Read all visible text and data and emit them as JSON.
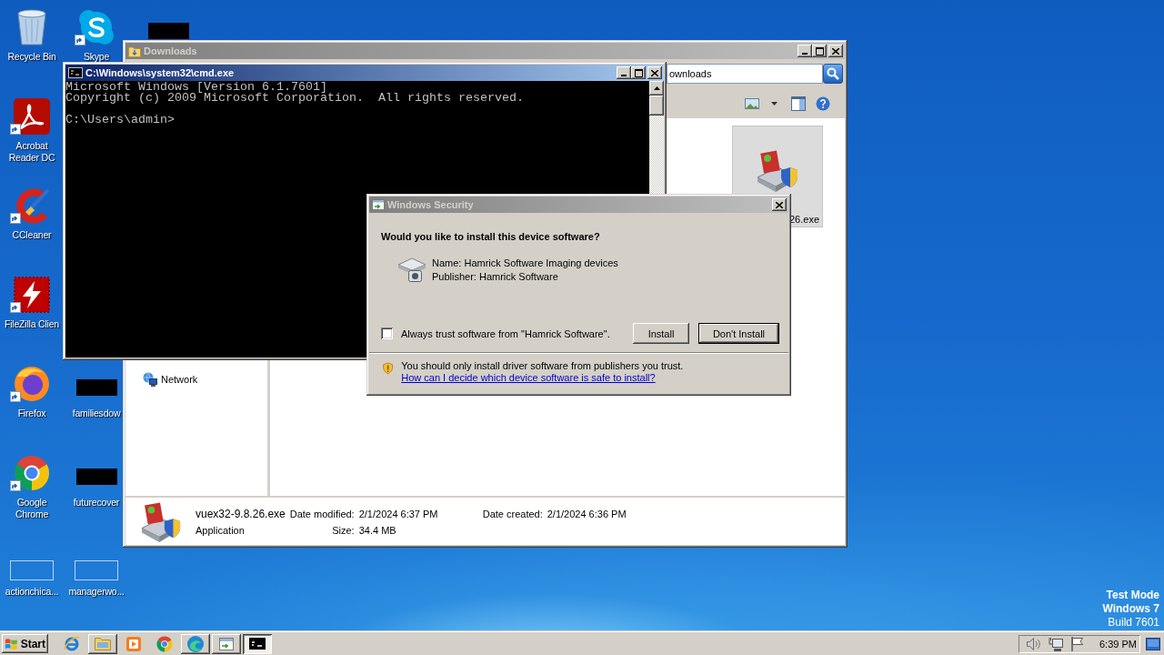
{
  "desktop": {
    "icon_columns": [
      {
        "top": [
          {
            "kind": "recycle-bin",
            "label": "Recycle Bin",
            "shortcut": false
          },
          {
            "kind": "pdf-reader",
            "label": "Acrobat Reader DC",
            "shortcut": true
          },
          {
            "kind": "cleaner",
            "label": "CCleaner",
            "shortcut": true
          },
          {
            "kind": "ftp-client",
            "label": "FileZilla Clien",
            "shortcut": true
          },
          {
            "kind": "fox-browser",
            "label": "Firefox",
            "shortcut": true
          },
          {
            "kind": "wheel-browser",
            "label": "Google Chrome",
            "shortcut": true
          },
          {
            "kind": "blank-file",
            "label": "actionchica...",
            "shortcut": false
          }
        ]
      },
      {
        "top": [
          {
            "kind": "messenger",
            "label": "Skype",
            "shortcut": true
          }
        ],
        "bottom": [
          {
            "kind": "redacted",
            "label": "familiesdow",
            "shortcut": false
          },
          {
            "kind": "redacted",
            "label": "futurecover",
            "shortcut": false
          },
          {
            "kind": "blank-file",
            "label": "managerwo...",
            "shortcut": false
          }
        ]
      },
      {
        "top": [
          {
            "kind": "redacted",
            "shortcut": false
          }
        ]
      }
    ],
    "system_notice": {
      "mode": "Test Mode",
      "os": "Windows 7",
      "build": "Build 7601"
    }
  },
  "explorer_window": {
    "title": "Downloads",
    "active": false,
    "search": {
      "value": "ownloads"
    },
    "nav_items": [
      {
        "label": "Network",
        "selected": false
      }
    ],
    "files": [
      {
        "label": "26.exe",
        "selected": true
      }
    ],
    "details": {
      "name": "vuex32-9.8.26.exe",
      "type": "Application",
      "date_modified": {
        "label": "Date modified:",
        "value": "2/1/2024 6:37 PM"
      },
      "date_created": {
        "label": "Date created:",
        "value": "2/1/2024 6:36 PM"
      },
      "size": {
        "label": "Size:",
        "value": "34.4 MB"
      }
    }
  },
  "cmd_window": {
    "title": "C:\\Windows\\system32\\cmd.exe",
    "active": true,
    "output": [
      "Microsoft Windows [Version 6.1.7601]",
      "Copyright (c) 2009 Microsoft Corporation.  All rights reserved."
    ],
    "prompt": "C:\\Users\\admin>"
  },
  "security_dialog": {
    "title": "Windows Security",
    "active": false,
    "question": "Would you like to install this device software?",
    "device": {
      "name": "Name: Hamrick Software Imaging devices",
      "publisher": "Publisher: Hamrick Software"
    },
    "trust_checkbox": {
      "label": "Always trust software from \"Hamrick Software\".",
      "checked": false
    },
    "buttons": [
      {
        "label": "Install",
        "default": false
      },
      {
        "label": "Don't Install",
        "default": true
      }
    ],
    "warning": {
      "text": "You should only install driver software from publishers you trust.",
      "link": "How can I decide which device software is safe to install?"
    }
  },
  "taskbar": {
    "start": "Start",
    "items": [
      {
        "kind": "globe-e",
        "running": false,
        "selected": false
      },
      {
        "kind": "folder",
        "running": true,
        "selected": false
      },
      {
        "kind": "player",
        "running": false,
        "selected": false
      },
      {
        "kind": "wheel",
        "running": false,
        "selected": false
      },
      {
        "kind": "wave",
        "running": true,
        "selected": false
      },
      {
        "kind": "dialog",
        "running": true,
        "selected": false
      },
      {
        "kind": "console",
        "running": true,
        "selected": true
      }
    ],
    "clock": "6:39 PM"
  }
}
